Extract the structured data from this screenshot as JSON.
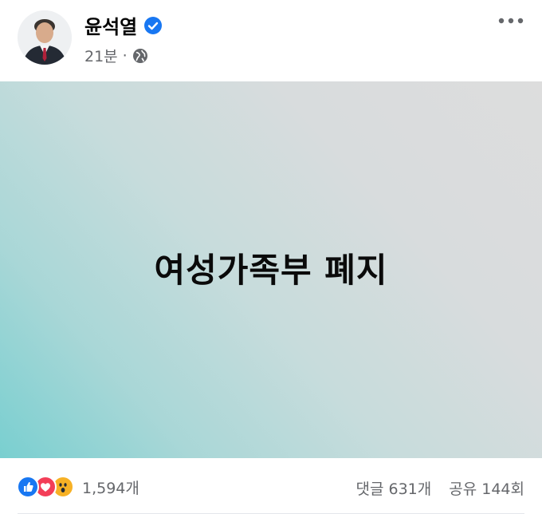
{
  "post": {
    "author": "윤석열",
    "verified_icon": "verified-badge-icon",
    "time": "21분",
    "separator": "·",
    "privacy_icon": "globe-icon",
    "image_text": "여성가족부 폐지"
  },
  "menu": {
    "icon": "more-options-icon"
  },
  "reactions": {
    "icons": [
      "like-icon",
      "love-icon",
      "wow-icon"
    ],
    "total": "1,594개"
  },
  "counts": {
    "comments": "댓글 631개",
    "shares": "공유 144회"
  },
  "colors": {
    "like": "#1877f2",
    "love": "#f33e58",
    "wow": "#f7b125",
    "verified": "#1877f2",
    "secondary_text": "#65676b"
  }
}
